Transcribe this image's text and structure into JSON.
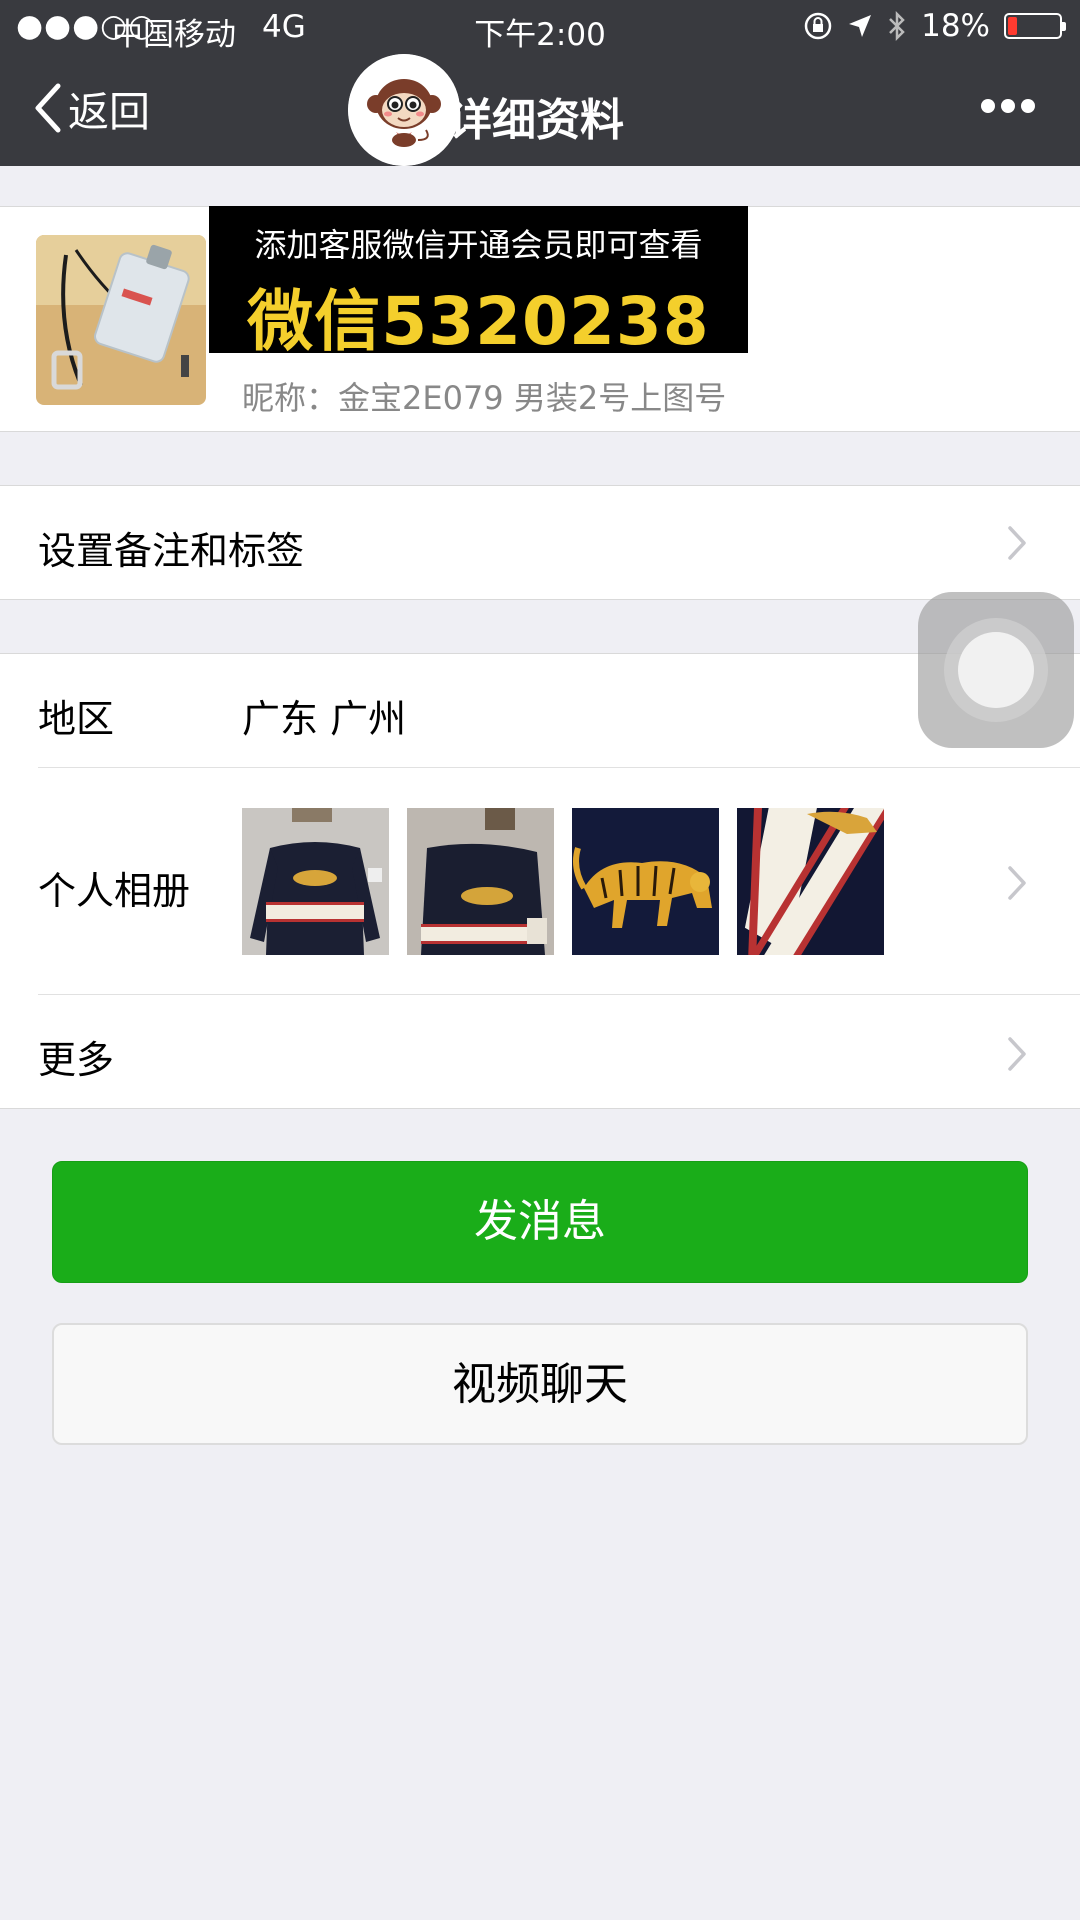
{
  "status_bar": {
    "signal": "●●●○○",
    "carrier": "中国移动",
    "network": "4G",
    "time": "下午2:00",
    "battery_percent": "18%",
    "battery_level": 0.18,
    "icons": [
      "orientation-lock-icon",
      "location-arrow-icon",
      "bluetooth-icon",
      "battery-icon"
    ]
  },
  "nav": {
    "back_label": "返回",
    "title": "详细资料",
    "more_icon": "more-dots-icon"
  },
  "profile": {
    "nickname": "昵称：金宝2E079  男装2号上图号"
  },
  "promo": {
    "line1": "添加客服微信开通会员即可查看",
    "line2": "微信5320238"
  },
  "rows": {
    "remark_label": "设置备注和标签",
    "region_label": "地区",
    "region_value": "广东 广州",
    "album_label": "个人相册",
    "more_label": "更多"
  },
  "buttons": {
    "send_message": "发消息",
    "video_chat": "视频聊天"
  },
  "colors": {
    "nav_bg": "#393a3f",
    "primary_green": "#1aad19",
    "promo_yellow": "#f4cf2c",
    "page_bg": "#efeff4"
  }
}
